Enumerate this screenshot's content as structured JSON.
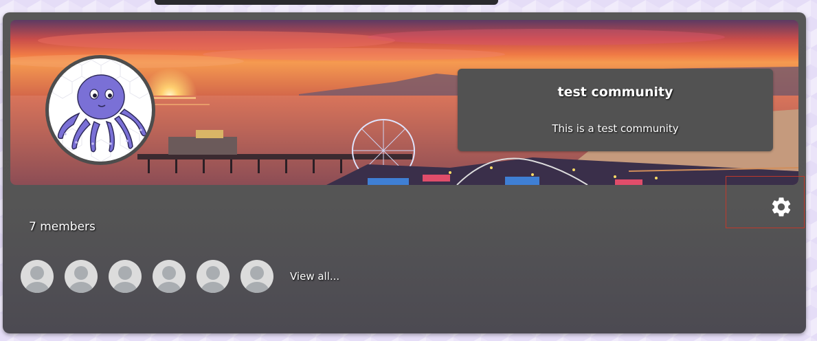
{
  "community": {
    "name": "test community",
    "description": "This is a test community"
  },
  "members": {
    "count_label": "7 members",
    "shown_avatars": 6,
    "view_all_label": "View all..."
  },
  "icons": {
    "settings": "gear-icon",
    "avatar": "octopus-icon",
    "member": "user-icon"
  },
  "colors": {
    "card": "#555555",
    "info_box": "#525252",
    "settings_highlight": "#c0392b"
  }
}
